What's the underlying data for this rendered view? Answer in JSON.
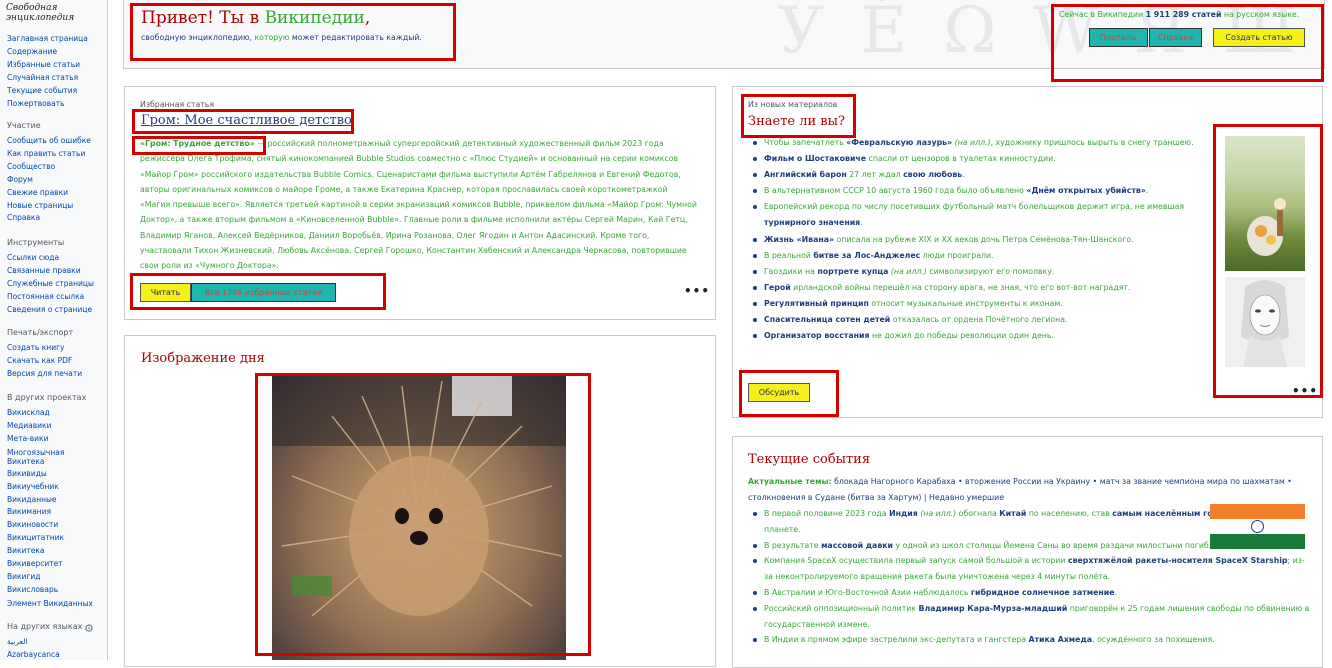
{
  "sidebar": {
    "logo_text": "Свободная энциклопедия",
    "nav": [
      "Заглавная страница",
      "Содержание",
      "Избранные статьи",
      "Случайная статья",
      "Текущие события",
      "Пожертвовать"
    ],
    "participation": {
      "title": "Участие",
      "items": [
        "Сообщить об ошибке",
        "Как править статьи",
        "Сообщество",
        "Форум",
        "Свежие правки",
        "Новые страницы",
        "Справка"
      ]
    },
    "tools": {
      "title": "Инструменты",
      "items": [
        "Ссылки сюда",
        "Связанные правки",
        "Служебные страницы",
        "Постоянная ссылка",
        "Сведения о странице"
      ]
    },
    "print": {
      "title": "Печать/экспорт",
      "items": [
        "Создать книгу",
        "Скачать как PDF",
        "Версия для печати"
      ]
    },
    "projects": {
      "title": "В других проектах",
      "items": [
        "Викисклад",
        "Медиавики",
        "Мета-вики",
        "Многоязычная Викитека",
        "Викивиды",
        "Викиучебник",
        "Викиданные",
        "Викимания",
        "Викиновости",
        "Викицитатник",
        "Викитека",
        "Викиверситет",
        "Викигид",
        "Викисловарь",
        "Элемент Викиданных"
      ]
    },
    "languages": {
      "title": "На других языках",
      "items": [
        "العربية",
        "Azərbaycanca"
      ]
    }
  },
  "banner": {
    "title_prefix": "Привет! Ты в ",
    "title_link": "Википедии",
    "title_suffix": ",",
    "subtitle_1": "свободную энциклопедию, ",
    "subtitle_link": "которую",
    "subtitle_2": " может редактировать каждый.",
    "stats_prefix": "Сейчас в Википедии ",
    "stats_count": "1 911 289 статей",
    "stats_suffix": " на русском языке.",
    "btn_portals": "Порталы",
    "btn_help": "Справка",
    "btn_create": "Создать статью",
    "watermark": "У É Ω W Я Ш"
  },
  "featured": {
    "label": "Избранная статья",
    "title": "Гром: Мое счастливое детство",
    "lead_link": "«Гром: Трудное детство»",
    "body": "— российский полнометражный супергеройский детективный художественный фильм 2023 года режиссёра Олега Трофима, снятый кинокомпанией Bubble Studios совместно с «Плюс Студией» и основанный на серии комиксов «Майор Гром» российского издательства Bubble Comics. Сценаристами фильма выступили Артём Габрелянов и Евгений Федотов, авторы оригинальных комиксов о майоре Громе, а также Екатерина Краснер, которая прославилась своей короткометражкой «Магия превыше всего». Является третьей картиной в серии экранизаций комиксов Bubble, приквелом фильма «Майор Гром: Чумной Доктор», а также вторым фильмом в «Киновселенной Bubble». Главные роли в фильме исполнили актёры Сергей Марин, Кай Гетц, Владимир Яганов, Алексей Ведёрников, Даниил Воробьёв, Ирина Розанова, Олег Ягодин и Антон Адасинский. Кроме того, участвовали Тихон Жизневский, Любовь Аксёнова, Сергей Горошко, Константин Хабенский и Александра Черкасова, повторившие свои роли из «Чумного Доктора».",
    "btn_read": "Читать",
    "btn_all": "Все 1769 избранных статей",
    "more": "•••"
  },
  "dyk": {
    "label": "Из новых материалов",
    "title": "Знаете ли вы?",
    "facts": [
      "Чтобы запечатлеть <b>«Февральскую лазурь»</b> <i>(на илл.)</i>, художнику пришлось вырыть в снегу траншею.",
      "<b>Фильм о Шостаковиче</b> спасли от цензоров в туалетах кинностудии.",
      "<b>Английский барон</b> 27 лет ждал <b>свою любовь</b>.",
      "В альтернативном СССР 10 августа 1960 года было объявлено <b>«Днём открытых убийств»</b>.",
      "Европейский рекорд по числу посетивших футбольный матч болельщиков держит игра, не имевшая <b>турнирного значения</b>.",
      "<b>Жизнь «Ивана»</b> описала на рубеже XIX и XX веков дочь Петра Семёнова-Тян-Шанского.",
      "В реальной <b>битве за Лос-Анджелес</b> люди проиграли.",
      "Гвоздики на <b>портрете купца</b> <i>(на илл.)</i> символизируют его помолвку.",
      "<b>Герой</b> ирландской войны перешёл на сторону врага, не зная, что его вот-вот наградят.",
      "<b>Регулятивный принцип</b> относит музыкальные инструменты к иконам.",
      "<b>Спасительница сотен детей</b> отказалась от ордена Почётного легиона.",
      "<b>Организатор восстания</b> не дожил до победы революции один день."
    ],
    "btn_discuss": "Обсудить",
    "more": "•••"
  },
  "potd": {
    "title": "Изображение дня"
  },
  "news": {
    "title": "Текущие события",
    "topics_label": "Актуальные темы:",
    "topics": " блокада Нагорного Карабаха • вторжение России на Украину • матч за звание чемпиона мира по шахматам • столкновения в Судане (битва за Хартум) | Недавно умершие",
    "items": [
      "В первой половине 2023 года <b>Индия</b> <i>(на илл.)</i> обогнала <b>Китай</b> по населению, став <b>самым населённым государством</b> на планете.",
      "В результате <b>массовой давки</b> у одной из школ столицы Йемена Саны во время раздачи милостыни погибло свыше 90 человек.",
      "Компания SpaceX осуществила первый запуск самой большой в истории <b>сверхтяжёлой ракеты-носителя SpaceX Starship</b>; из-за неконтролируемого вращения ракета была уничтожена через 4 минуты полёта.",
      "В Австралии и Юго-Восточной Азии наблюдалось <b>гибридное солнечное затмение</b>.",
      "Российский оппозиционный политик <b>Владимир Кара-Мурза-младший</b> приговорён к 25 годам лишения свободы по обвинению в государственной измене.",
      "В Индии в прямом эфире застрелили экс-депутата и гангстера <b>Атика Ахмеда</b>, осуждённого за похищения."
    ]
  }
}
